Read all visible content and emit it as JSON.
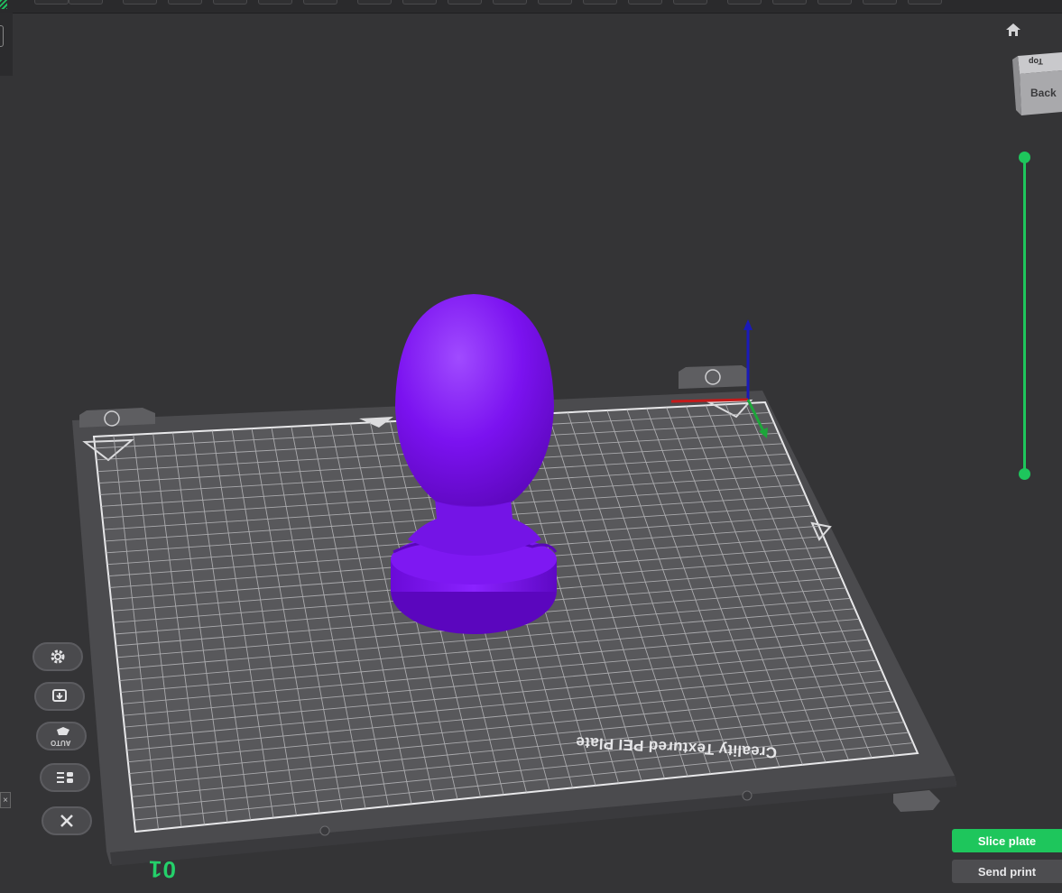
{
  "viewport": {
    "view_cube": {
      "top_face": "Top",
      "back_face": "Back"
    },
    "plate": {
      "label": "Creality Textured PEI Plate",
      "number": "01"
    },
    "model": {
      "color": "#7b12f0"
    },
    "axes": {
      "x_color": "#c41a1a",
      "y_color": "#1da63a",
      "z_color": "#1a1ab8"
    }
  },
  "layer_slider": {
    "color": "#1ec65c"
  },
  "left_tools": {
    "auto_label": "AUTO"
  },
  "actions": {
    "slice_label": "Slice plate",
    "send_label": "Send print"
  },
  "colors": {
    "accent": "#1ec65c",
    "background": "#343436",
    "bed": "#4a4a4d"
  }
}
